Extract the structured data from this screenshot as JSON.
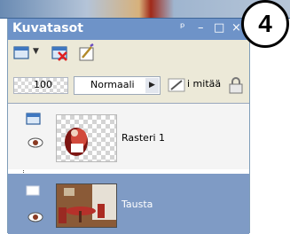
{
  "panel": {
    "title": "Kuvatasot",
    "title_buttons": [
      "ᵖ",
      "–",
      "□",
      "×"
    ]
  },
  "toolbar": {
    "icons": [
      "new-layer-icon",
      "delete-layer-icon",
      "edit-layer-icon"
    ]
  },
  "controls": {
    "opacity": "100",
    "blend_mode": "Normaali",
    "lock_label": "i mitää"
  },
  "layers": [
    {
      "name": "Rasteri 1",
      "visible": true,
      "selected": false
    },
    {
      "name": "Tausta",
      "visible": true,
      "selected": true
    }
  ],
  "step_badge": "4"
}
